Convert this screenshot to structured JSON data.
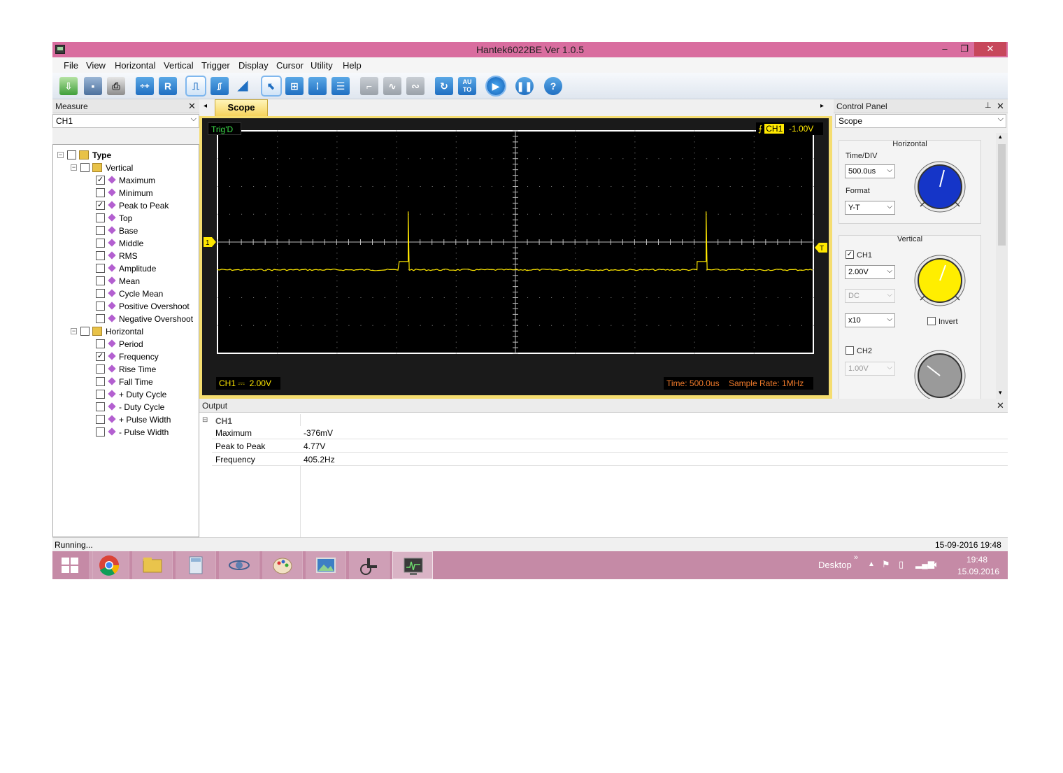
{
  "window": {
    "title": "Hantek6022BE Ver 1.0.5",
    "min": "–",
    "max": "❐",
    "close": "✕"
  },
  "menu": [
    "File",
    "View",
    "Horizontal",
    "Vertical",
    "Trigger",
    "Display",
    "Cursor",
    "Utility",
    "Help"
  ],
  "toolbar": {
    "auto_label": "AU\nTO",
    "record_label": "R",
    "help_label": "?"
  },
  "measure": {
    "title": "Measure",
    "channel": "CH1",
    "root": "Type",
    "vertical": "Vertical",
    "horizontal": "Horizontal",
    "vertical_items": [
      {
        "label": "Maximum",
        "checked": true
      },
      {
        "label": "Minimum",
        "checked": false
      },
      {
        "label": "Peak to Peak",
        "checked": true
      },
      {
        "label": "Top",
        "checked": false
      },
      {
        "label": "Base",
        "checked": false
      },
      {
        "label": "Middle",
        "checked": false
      },
      {
        "label": "RMS",
        "checked": false
      },
      {
        "label": "Amplitude",
        "checked": false
      },
      {
        "label": "Mean",
        "checked": false
      },
      {
        "label": "Cycle Mean",
        "checked": false
      },
      {
        "label": "Positive Overshoot",
        "checked": false
      },
      {
        "label": "Negative Overshoot",
        "checked": false
      }
    ],
    "horizontal_items": [
      {
        "label": "Period",
        "checked": false
      },
      {
        "label": "Frequency",
        "checked": true
      },
      {
        "label": "Rise Time",
        "checked": false
      },
      {
        "label": "Fall Time",
        "checked": false
      },
      {
        "label": "+ Duty Cycle",
        "checked": false
      },
      {
        "label": "- Duty Cycle",
        "checked": false
      },
      {
        "label": "+ Pulse Width",
        "checked": false
      },
      {
        "label": "- Pulse Width",
        "checked": false
      }
    ]
  },
  "scope": {
    "tab": "Scope",
    "trig_status": "Trig'D",
    "trig_channel": "CH1",
    "trig_level": "-1.00V",
    "ch1_marker": "1",
    "trigger_marker": "T",
    "bottom_ch": "CH1",
    "bottom_coupling": "⎓",
    "bottom_volts": "2.00V",
    "time_text": "Time: 500.0us",
    "rate_text": "Sample Rate: 1MHz",
    "trace_color": "#ffe800",
    "trace": {
      "baseline_div": -1.0,
      "pre_pulse_div": -0.7,
      "spike_div": 1.1,
      "pulses": [
        {
          "start_div": 3.05,
          "spike_div": 3.2,
          "end_div": 3.25
        },
        {
          "start_div": 8.05,
          "spike_div": 8.2,
          "end_div": 8.25
        }
      ]
    }
  },
  "control": {
    "title": "Control Panel",
    "mode": "Scope",
    "horizontal_title": "Horizontal",
    "timediv_label": "Time/DIV",
    "timediv": "500.0us",
    "format_label": "Format",
    "format": "Y-T",
    "vertical_title": "Vertical",
    "ch1_label": "CH1",
    "ch1_checked": true,
    "ch1_volts": "2.00V",
    "ch1_coupling": "DC",
    "ch1_probe": "x10",
    "invert_label": "Invert",
    "ch2_label": "CH2",
    "ch2_checked": false,
    "ch2_volts": "1.00V",
    "knob_colors": {
      "horizontal": "#1535c8",
      "ch1": "#ffee00",
      "ch2": "#9a9a9a"
    }
  },
  "output": {
    "title": "Output",
    "group": "CH1",
    "rows": [
      {
        "name": "Maximum",
        "value": "-376mV"
      },
      {
        "name": "Peak to Peak",
        "value": "4.77V"
      },
      {
        "name": "Frequency",
        "value": "405.2Hz"
      }
    ]
  },
  "status": {
    "left": "Running...",
    "right": "15-09-2016  19:48"
  },
  "taskbar": {
    "desktop": "Desktop",
    "chevron": "»",
    "time": "19:48",
    "date": "15.09.2016"
  }
}
